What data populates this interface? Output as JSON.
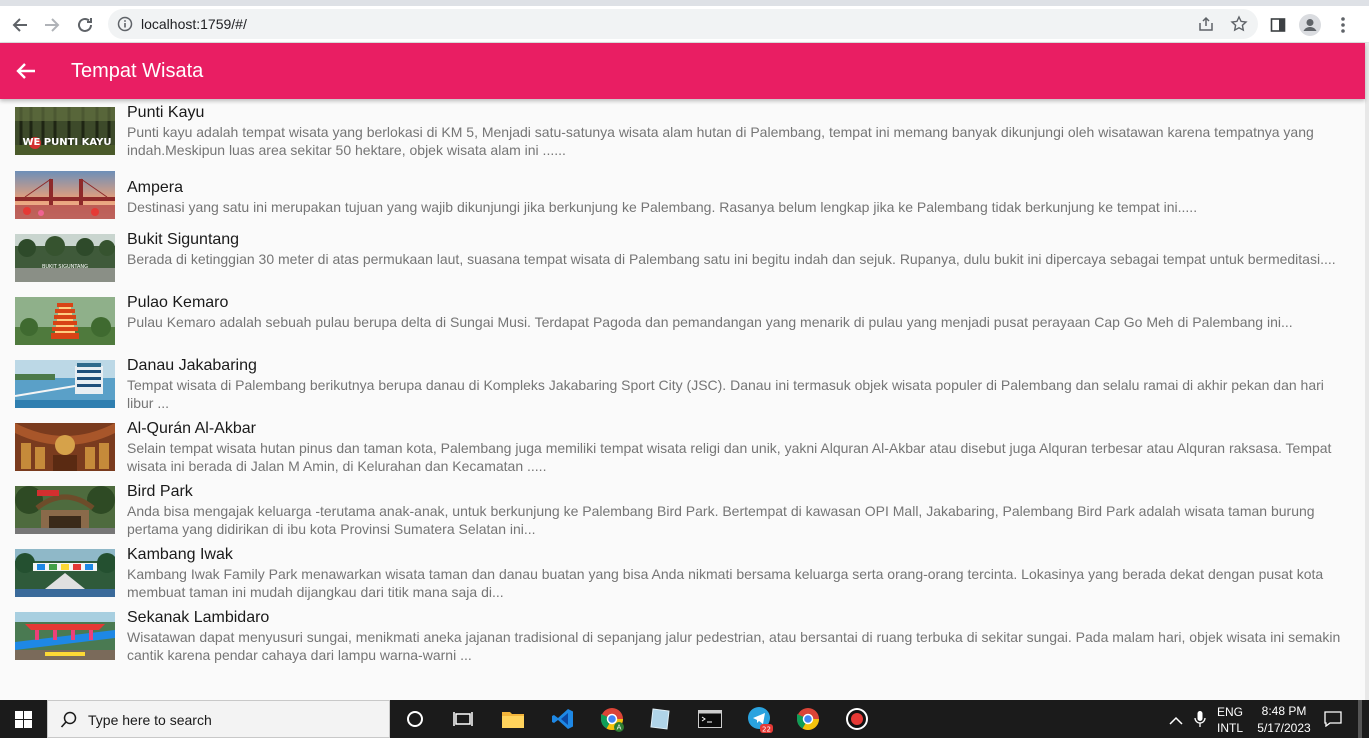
{
  "browser": {
    "url": "localhost:1759/#/"
  },
  "appbar": {
    "title": "Tempat Wisata"
  },
  "places": [
    {
      "name": "Punti Kayu",
      "description": "Punti kayu adalah tempat wisata yang berlokasi di KM 5, Menjadi satu-satunya wisata alam hutan di Palembang, tempat ini memang banyak dikunjungi oleh wisatawan karena tempatnya yang indah.Meskipun luas area sekitar 50 hektare, objek wisata alam ini  ......",
      "thumb_text": "WE PUNTI KAYU"
    },
    {
      "name": "Ampera",
      "description": "Destinasi yang satu ini merupakan tujuan yang wajib dikunjungi jika berkunjung ke Palembang. Rasanya belum lengkap jika ke Palembang tidak berkunjung ke tempat ini....."
    },
    {
      "name": "Bukit Siguntang",
      "description": "Berada di ketinggian 30 meter di atas permukaan laut, suasana tempat wisata di Palembang satu ini begitu indah dan sejuk. Rupanya, dulu bukit ini dipercaya sebagai tempat untuk bermeditasi....",
      "thumb_text": "BUKIT SIGUNTANG"
    },
    {
      "name": "Pulao Kemaro",
      "description": "Pulau Kemaro adalah sebuah pulau berupa delta di Sungai Musi. Terdapat Pagoda dan pemandangan yang menarik di pulau yang menjadi pusat perayaan Cap Go Meh di Palembang ini..."
    },
    {
      "name": "Danau Jakabaring",
      "description": "Tempat wisata di Palembang berikutnya berupa danau di Kompleks Jakabaring Sport City (JSC). Danau ini termasuk objek wisata populer di Palembang dan selalu ramai di akhir pekan dan hari libur ..."
    },
    {
      "name": "Al-Qurán Al-Akbar",
      "description": "Selain tempat wisata hutan pinus dan taman kota, Palembang juga memiliki tempat wisata religi dan unik, yakni Alquran Al-Akbar atau disebut juga Alquran terbesar atau Alquran raksasa. Tempat wisata ini berada di Jalan M Amin, di Kelurahan dan Kecamatan ....."
    },
    {
      "name": "Bird Park",
      "description": "Anda bisa mengajak keluarga -terutama anak-anak, untuk berkunjung ke Palembang Bird Park. Bertempat di kawasan OPI Mall, Jakabaring, Palembang Bird Park adalah wisata taman burung pertama yang didirikan di ibu kota Provinsi Sumatera Selatan ini..."
    },
    {
      "name": "Kambang Iwak",
      "description": "Kambang Iwak Family Park menawarkan wisata taman dan danau buatan yang bisa Anda nikmati bersama keluarga serta orang-orang tercinta. Lokasinya yang berada dekat dengan pusat kota membuat taman ini mudah dijangkau dari titik mana saja di..."
    },
    {
      "name": "Sekanak Lambidaro",
      "description": "Wisatawan dapat menyusuri sungai, menikmati aneka jajanan tradisional di sepanjang jalur pedestrian, atau bersantai di ruang terbuka di sekitar sungai. Pada malam hari, objek wisata ini semakin cantik karena pendar cahaya dari lampu warna-warni ..."
    }
  ],
  "taskbar": {
    "search_placeholder": "Type here to search",
    "lang_top": "ENG",
    "lang_bottom": "INTL",
    "time": "8:48 PM",
    "date": "5/17/2023",
    "telegram_badge": "22",
    "accent": "#e91e63"
  }
}
